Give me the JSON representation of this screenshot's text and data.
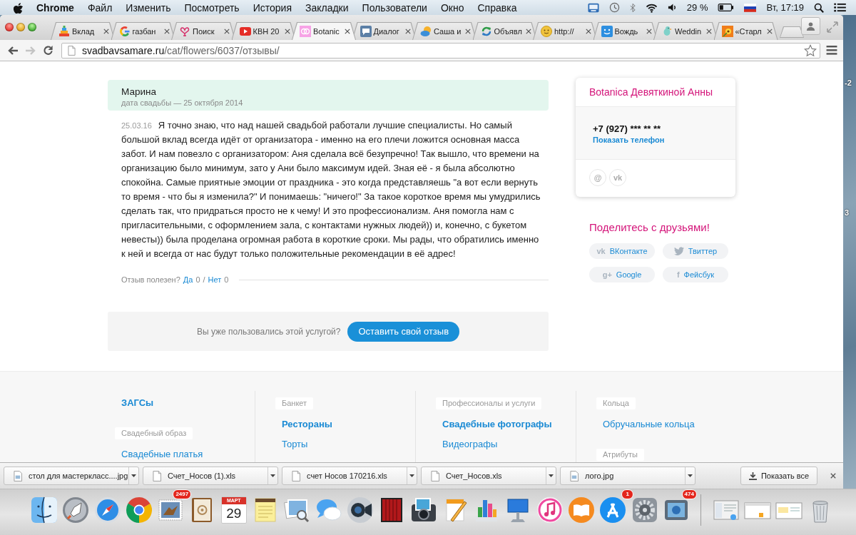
{
  "menu_bar": {
    "app_name": "Chrome",
    "menus": [
      "Файл",
      "Изменить",
      "Посмотреть",
      "История",
      "Закладки",
      "Пользователи",
      "Окно",
      "Справка"
    ],
    "battery_percent": "29 %",
    "clock": "Вт, 17:19"
  },
  "browser": {
    "tabs": [
      {
        "title": "Вклад",
        "selected": false
      },
      {
        "title": "газбан",
        "selected": false
      },
      {
        "title": "Поиск",
        "selected": false
      },
      {
        "title": "КВН 20",
        "selected": false
      },
      {
        "title": "Botanic",
        "selected": true
      },
      {
        "title": "Диалог",
        "selected": false
      },
      {
        "title": "Саша и",
        "selected": false
      },
      {
        "title": "Объявл",
        "selected": false
      },
      {
        "title": "http://",
        "selected": false
      },
      {
        "title": "Вождь",
        "selected": false
      },
      {
        "title": "Weddin",
        "selected": false
      },
      {
        "title": "«Старл",
        "selected": false
      }
    ],
    "navigation": [
      {
        "kind": "back",
        "disabled": false
      },
      {
        "kind": "forward",
        "disabled": true
      },
      {
        "kind": "reload",
        "disabled": false
      }
    ],
    "address": {
      "host": "svadbavsamare.ru",
      "path": "/cat/flowers/6037/отзывы/"
    }
  },
  "review": {
    "author": "Марина",
    "wedding_date": "дата свадьбы — 25 октября 2014",
    "posted": "25.03.16",
    "text": "Я точно знаю, что над нашей свадьбой работали лучшие специалисты. Но самый большой вклад всегда идёт от организатора - именно на его плечи ложится основная масса забот. И нам повезло с организатором: Аня сделала всё безупречно! Так вышло, что времени на организацию было минимум, зато у Ани было максимум идей. Зная её - я была абсолютно спокойна. Самые приятные эмоции от праздника - это когда представляешь \"а вот если вернуть то время - что бы я изменила?\" И понимаешь: \"ничего!\" За такое короткое время мы умудрились сделать так, что придраться просто не к чему! И это профессионализм. Аня помогла нам с пригласительными, с оформлением зала, с контактами нужных людей)) и, конечно, с букетом невесты)) была проделана огромная работа в короткие сроки. Мы рады, что обратились именно к ней и всегда от нас будут только положительные рекомендации в её адрес!",
    "helpful": {
      "question": "Отзыв полезен?",
      "yes": "Да",
      "yes_count": "0",
      "divider": "/",
      "no": "Нет",
      "no_count": "0"
    }
  },
  "call_to_action": {
    "question": "Вы уже пользовались этой услугой?",
    "button": "Оставить свой отзыв"
  },
  "vendor_card": {
    "title": "Botanica Девяткиной Анны",
    "phone": "+7 (927) *** ** **",
    "show_phone": "Показать телефон",
    "contacts": [
      "@",
      "vk"
    ]
  },
  "share": {
    "title": "Поделитесь с друзьями!",
    "buttons": [
      {
        "icon": "vk",
        "label": "ВКонтакте"
      },
      {
        "label": "Твиттер"
      },
      {
        "icon": "g+",
        "label": "Google"
      },
      {
        "icon": "f",
        "label": "Фейсбук"
      }
    ]
  },
  "footer": {
    "columns": [
      {
        "items": [
          {
            "kind": "link",
            "text": "ЗАГСы",
            "bold": true
          },
          {
            "kind": "heading",
            "text": "Свадебный образ"
          },
          {
            "kind": "link",
            "text": "Свадебные платья",
            "bold": false
          }
        ]
      },
      {
        "items": [
          {
            "kind": "heading",
            "text": "Банкет"
          },
          {
            "kind": "link",
            "text": "Рестораны",
            "bold": true
          },
          {
            "kind": "link",
            "text": "Торты",
            "bold": false
          }
        ]
      },
      {
        "items": [
          {
            "kind": "heading",
            "text": "Профессионалы и услуги"
          },
          {
            "kind": "link",
            "text": "Свадебные фотографы",
            "bold": true
          },
          {
            "kind": "link",
            "text": "Видеографы",
            "bold": false
          }
        ]
      },
      {
        "items": [
          {
            "kind": "heading",
            "text": "Кольца"
          },
          {
            "kind": "link",
            "text": "Обручальные кольца",
            "bold": false
          },
          {
            "kind": "heading",
            "text": "Атрибуты"
          }
        ]
      }
    ]
  },
  "downloads": {
    "items": [
      {
        "kind": "image",
        "name": "стол для мастеркласс....jpg"
      },
      {
        "kind": "document",
        "name": "Счет_Носов (1).xls"
      },
      {
        "kind": "document",
        "name": "счет Носов 170216.xls"
      },
      {
        "kind": "document",
        "name": "Счет_Носов.xls"
      },
      {
        "kind": "image",
        "name": "лого.jpg"
      }
    ],
    "show_all": "Показать все"
  },
  "desktop": {
    "labels": [
      "-2",
      "3"
    ]
  },
  "dock": {
    "calendar_month": "МАРТ",
    "calendar_day": "29",
    "badges": [
      "2497",
      "1",
      "474"
    ]
  }
}
